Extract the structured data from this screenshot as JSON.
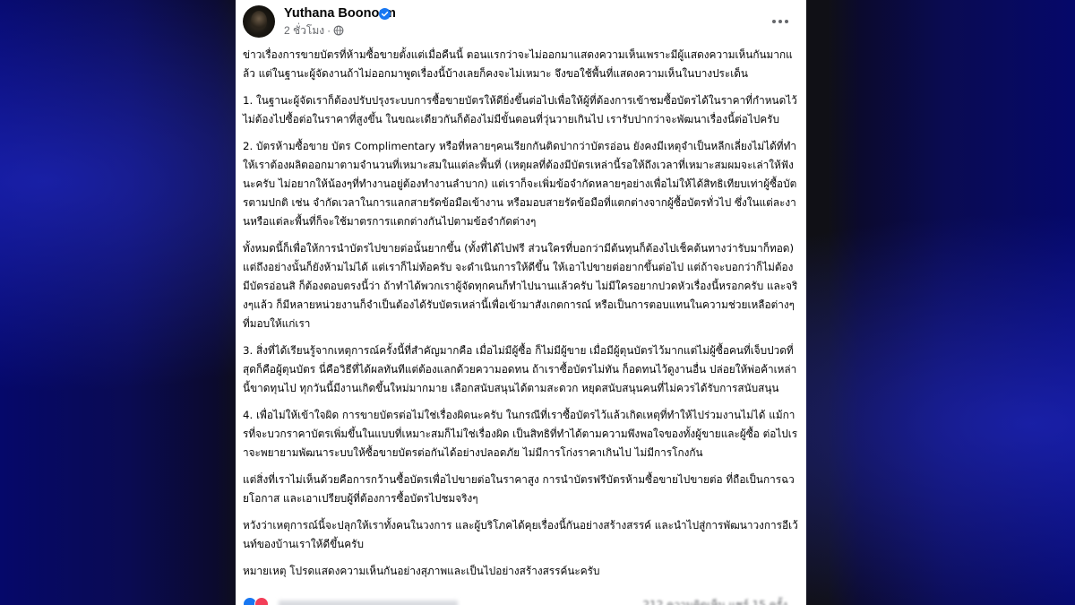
{
  "post": {
    "author": "Yuthana Boonorm",
    "timestamp": "2 ชั่วโมง",
    "paragraphs": [
      "ข่าวเรื่องการขายบัตรที่ห้ามซื้อขายตั้งแต่เมื่อคืนนี้ ตอนแรกว่าจะไม่ออกมาแสดงความเห็นเพราะมีผู้แสดงความเห็นกันมากแล้ว แต่ในฐานะผู้จัดงานถ้าไม่ออกมาพูดเรื่องนี้บ้างเลยก็คงจะไม่เหมาะ จึงขอใช้พื้นที่แสดงความเห็นในบางประเด็น",
      "1. ในฐานะผู้จัดเราก็ต้องปรับปรุงระบบการซื้อขายบัตรให้ดียิ่งขึ้นต่อไปเพื่อให้ผู้ที่ต้องการเข้าชมซื้อบัตรได้ในราคาที่กำหนดไว้ ไม่ต้องไปซื้อต่อในราคาที่สูงขึ้น ในขณะเดียวกันก็ต้องไม่มีขั้นตอนที่วุ่นวายเกินไป เรารับปากว่าจะพัฒนาเรื่องนี้ต่อไปครับ",
      "2. บัตรห้ามซื้อขาย บัตร Complimentary หรือที่หลายๆคนเรียกกันติดปากว่าบัตรอ่อน ยังคงมีเหตุจำเป็นหลีกเลี่ยงไม่ได้ที่ทำให้เราต้องผลิตออกมาตามจำนวนที่เหมาะสมในแต่ละพื้นที่ (เหตุผลที่ต้องมีบัตรเหล่านี้รอให้ถึงเวลาที่เหมาะสมผมจะเล่าให้ฟังนะครับ ไม่อยากให้น้องๆที่ทำงานอยู่ต้องทำงานลำบาก) แต่เราก็จะเพิ่มข้อจำกัดหลายๆอย่างเพื่อไม่ให้ได้สิทธิเทียบเท่าผู้ซื้อบัตรตามปกติ เช่น จำกัดเวลาในการแลกสายรัดข้อมือเข้างาน หรือมอบสายรัดข้อมือที่แตกต่างจากผู้ซื้อบัตรทั่วไป ซึ่งในแต่ละงานหรือแต่ละพื้นที่ก็จะใช้มาตรการแตกต่างกันไปตามข้อจำกัดต่างๆ",
      "ทั้งหมดนี้ก็เพื่อให้การนำบัตรไปขายต่อนั้นยากขึ้น (ทั้งที่ได้ไปฟรี ส่วนใครที่บอกว่ามีต้นทุนก็ต้องไปเช็คต้นทางว่ารับมาก็ทอด) แต่ถึงอย่างนั้นก็ยังห้ามไม่ได้ แต่เราก็ไม่ท้อครับ จะดำเนินการให้ดีขึ้น ให้เอาไปขายต่อยากขึ้นต่อไป แต่ถ้าจะบอกว่าก็ไม่ต้องมีบัตรอ่อนสิ ก็ต้องตอบตรงนี้ว่า ถ้าทำได้พวกเราผู้จัดทุกคนก็ทำไปนานแล้วครับ ไม่มีใครอยากปวดหัวเรื่องนี้หรอกครับ และจริงๆแล้ว ก็มีหลายหน่วยงานก็จำเป็นต้องได้รับบัตรเหล่านี้เพื่อเข้ามาสังเกตการณ์ หรือเป็นการตอบแทนในความช่วยเหลือต่างๆที่มอบให้แก่เรา",
      "3. สิ่งที่ได้เรียนรู้จากเหตุการณ์ครั้งนี้ที่สำคัญมากคือ เมื่อไม่มีผู้ซื้อ ก็ไม่มีผู้ขาย เมื่อมีผู้ตุนบัตรไว้มากแต่ไม่ผู้ซื้อคนที่เจ็บปวดที่สุดก็คือผู้ตุนบัตร นี่คือวิธีที่ได้ผลทันทีแต่ต้องแลกด้วยความอดทน ถ้าเราซื้อบัตรไม่ทัน ก็อดทนไว้ดูงานอื่น ปล่อยให้พ่อค้าเหล่านี้ขาดทุนไป ทุกวันนี้มีงานเกิดขึ้นใหม่มากมาย เลือกสนับสนุนได้ตามสะดวก หยุดสนับสนุนคนที่ไม่ควรได้รับการสนับสนุน",
      "4. เพื่อไม่ให้เข้าใจผิด การขายบัตรต่อไม่ใช่เรื่องผิดนะครับ ในกรณีที่เราซื้อบัตรไว้แล้วเกิดเหตุที่ทำให้ไปร่วมงานไม่ได้ แม้การที่จะบวกราคาบัตรเพิ่มขึ้นในแบบที่เหมาะสมก็ไม่ใช่เรื่องผิด เป็นสิทธิที่ทำได้ตามความพึงพอใจของทั้งผู้ขายและผู้ซื้อ ต่อไปเราจะพยายามพัฒนาระบบให้ซื้อขายบัตรต่อกันได้อย่างปลอดภัย ไม่มีการโก่งราคาเกินไป ไม่มีการโกงกัน",
      "แต่สิ่งที่เราไม่เห็นด้วยคือการกว้านซื้อบัตรเพื่อไปขายต่อในราคาสูง การนำบัตรฟรีบัตรห้ามซื้อขายไปขายต่อ ที่ถือเป็นการฉวยโอกาส และเอาเปรียบผู้ที่ต้องการซื้อบัตรไปชมจริงๆ",
      "หวังว่าเหตุการณ์นี้จะปลุกให้เราทั้งคนในวงการ และผู้บริโภคได้คุยเรื่องนี้กันอย่างสร้างสรรค์ และนำไปสู่การพัฒนาวงการอีเว้นท์ของบ้านเราให้ดีขึ้นครับ",
      "หมายเหตุ โปรดแสดงความเห็นกันอย่างสุภาพและเป็นไปอย่างสร้างสรรค์นะครับ"
    ],
    "footer_stats": "212 ความคิดเห็น  แชร์ 15 ครั้ง"
  },
  "icons": {
    "verified": "verified-badge-icon",
    "privacy": "globe-icon",
    "more": "more-options-icon",
    "reactions": [
      "like-reaction-icon",
      "love-reaction-icon"
    ]
  },
  "colors": {
    "verified_blue": "#1877f2",
    "text_primary": "#050505",
    "text_secondary": "#65676b",
    "like_blue": "#1877f2",
    "love_red": "#f33e58"
  }
}
